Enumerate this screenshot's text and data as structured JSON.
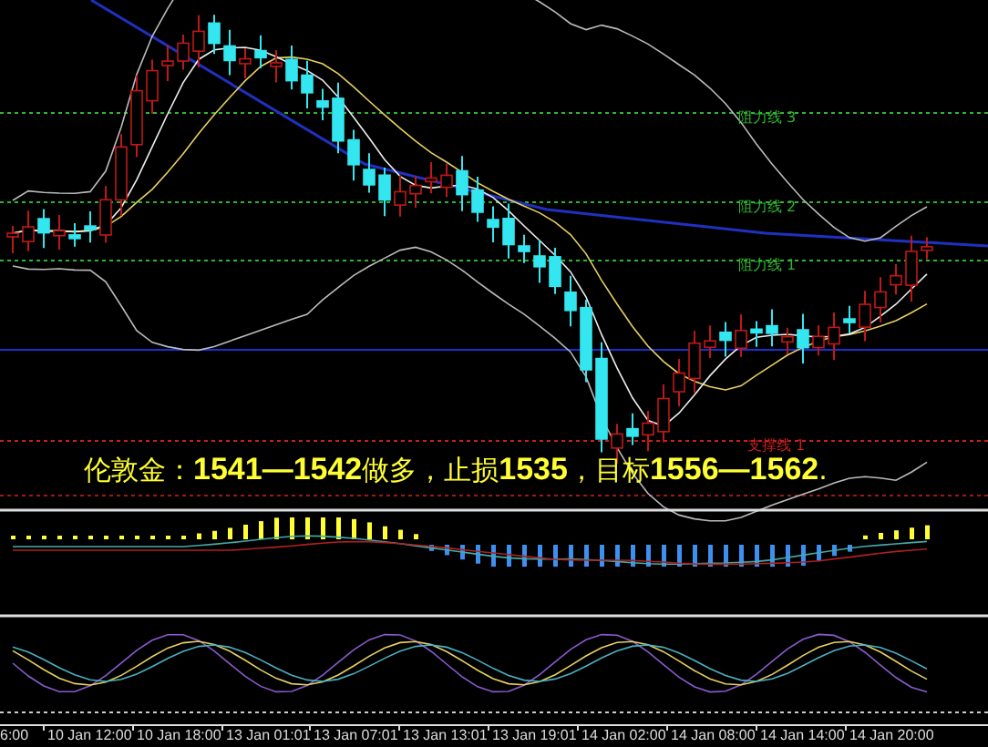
{
  "chart": {
    "level_labels": [
      {
        "text": "阻力线 3",
        "kind": "resistance"
      },
      {
        "text": "阻力线 2",
        "kind": "resistance"
      },
      {
        "text": "阻力线 1",
        "kind": "resistance"
      },
      {
        "text": "支撑线 1",
        "kind": "support"
      }
    ],
    "annotation": "伦敦金：**1541—1542**做多，止损**1535**，目标**1556—1562**.",
    "time_axis": [
      "6:00",
      "10 Jan 12:00",
      "10 Jan 18:00",
      "13 Jan 01:01",
      "13 Jan 07:01",
      "13 Jan 13:01",
      "13 Jan 19:01",
      "14 Jan 02:00",
      "14 Jan 08:00",
      "14 Jan 14:00",
      "14 Jan 20:00"
    ]
  }
}
